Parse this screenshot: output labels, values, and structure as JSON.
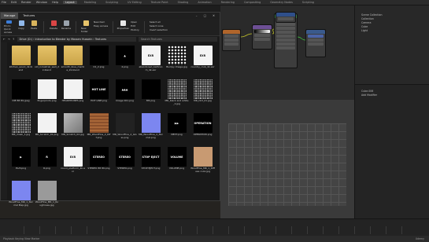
{
  "blender": {
    "menus": [
      "File",
      "Edit",
      "Render",
      "Window",
      "Help"
    ],
    "workspaces": [
      "Layout",
      "Modeling",
      "Sculpting",
      "UV Editing",
      "Texture Paint",
      "Shading",
      "Animation",
      "Rendering",
      "Compositing",
      "Geometry Nodes",
      "Scripting"
    ],
    "outliner": [
      "Scene Collection",
      "Collection",
      "Camera",
      "Cube",
      "Light"
    ],
    "properties_label": "Add Modifier",
    "object_name": "Cube.006",
    "statusbar": "Playback  Keying  View  Marker",
    "watermark": "Udemy"
  },
  "explorer": {
    "tab": "Manage",
    "title": "Textures",
    "window_controls": [
      "–",
      "□",
      "✕"
    ],
    "ribbon": {
      "buttons": [
        "Pin to Quick access",
        "Copy",
        "Paste",
        "Delete",
        "Rename",
        "New folder",
        "Properties"
      ],
      "small": [
        "Cut",
        "Copy path",
        "Paste shortcut",
        "Move to",
        "Copy to",
        "New item",
        "Easy access",
        "Open",
        "Edit",
        "History",
        "Select all",
        "Select none",
        "Invert selection"
      ],
      "groups": [
        "Clipboard",
        "Organize",
        "New",
        "Open",
        "Select"
      ]
    },
    "address": "Drive (D:) › Introduction to Blender by Mossen Hussein › Textures",
    "search_placeholder": "Search Textures",
    "files": [
      {
        "name": "kitchen_wood_4k.blend",
        "kind": "folder",
        "label": ""
      },
      {
        "name": "old_industrial_wall_2k.blend",
        "kind": "folder",
        "label": ""
      },
      {
        "name": "smooth_blue_marble_2k.blend",
        "kind": "folder",
        "label": ""
      },
      {
        "name": "01_2.png",
        "kind": "black",
        "label": ""
      },
      {
        "name": "4.png",
        "kind": "black",
        "label": "▲"
      },
      {
        "name": "abandoned_bathroom_4k.exr",
        "kind": "exr",
        "label": "EXR"
      },
      {
        "name": "Bumpy Image.jpg",
        "kind": "pattern",
        "label": ""
      },
      {
        "name": "country_club_4k.exr",
        "kind": "exr",
        "label": "EXR"
      },
      {
        "name": "DIE 88 89.jpeg",
        "kind": "black",
        "label": ""
      },
      {
        "name": "fingerprints.png",
        "kind": "white",
        "label": ""
      },
      {
        "name": "HEADPHONES.png",
        "kind": "white",
        "label": ""
      },
      {
        "name": "HOT LINE.png",
        "kind": "black",
        "label": "HOT LINE"
      },
      {
        "name": "Image 001.png",
        "kind": "black",
        "label": "▲▲▲"
      },
      {
        "name": "M5.png",
        "kind": "black",
        "label": ""
      },
      {
        "name": "MR_black and white_1.jpg",
        "kind": "noise",
        "label": ""
      },
      {
        "name": "MR_Dirt_01.jpg",
        "kind": "noise",
        "label": ""
      },
      {
        "name": "MR_mask_1.jpg",
        "kind": "noise",
        "label": ""
      },
      {
        "name": "MR_Scratch_01.png",
        "kind": "white",
        "label": ""
      },
      {
        "name": "MR_Scratch_02.jpg",
        "kind": "gray",
        "label": ""
      },
      {
        "name": "MR_WoodFine_2_Diff.png",
        "kind": "wood",
        "label": ""
      },
      {
        "name": "MR_WoodFine_2_Gloss.png",
        "kind": "dark",
        "label": ""
      },
      {
        "name": "MR_WoodFine_2_Normal.png",
        "kind": "blue",
        "label": ""
      },
      {
        "name": "NEXT.png",
        "kind": "black",
        "label": "▶▶"
      },
      {
        "name": "OPERATION.png",
        "kind": "black",
        "label": "OPERATION"
      },
      {
        "name": "PLAY.png",
        "kind": "black",
        "label": "▶"
      },
      {
        "name": "R.png",
        "kind": "black",
        "label": "R"
      },
      {
        "name": "round_platform_4k.exr",
        "kind": "exr",
        "label": "EXR"
      },
      {
        "name": "STEREO 88 89.png",
        "kind": "black",
        "label": "STEREO"
      },
      {
        "name": "STEREO.png",
        "kind": "black",
        "label": "STEREO"
      },
      {
        "name": "STOP EJECT.png",
        "kind": "black",
        "label": "STOP EJECT"
      },
      {
        "name": "VOLUME.png",
        "kind": "black",
        "label": "VOLUME"
      },
      {
        "name": "WoodFine_MR_1_Diffuse color.jpg",
        "kind": "woodlight",
        "label": ""
      },
      {
        "name": "WoodFine_MR_1_Normal Map.jpg",
        "kind": "blue",
        "label": ""
      },
      {
        "name": "WoodFine_MR_1_Roughness.jpg",
        "kind": "midgray",
        "label": ""
      }
    ]
  }
}
